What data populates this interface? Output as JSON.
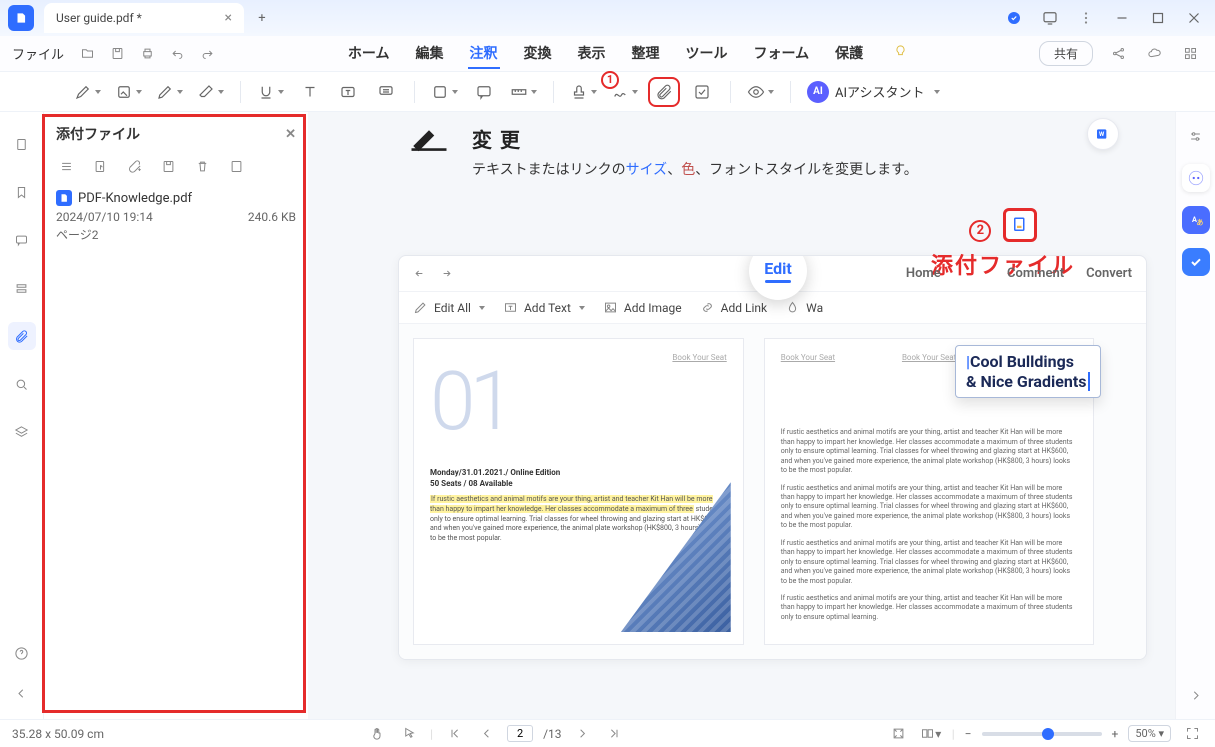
{
  "titlebar": {
    "tab_title": "User guide.pdf *"
  },
  "menubar": {
    "file": "ファイル",
    "items": [
      "ホーム",
      "編集",
      "注釈",
      "変換",
      "表示",
      "整理",
      "ツール",
      "フォーム",
      "保護"
    ],
    "active_index": 2,
    "share": "共有"
  },
  "toolbar": {
    "badge1": "1",
    "ai_label": "AIアシスタント"
  },
  "side_panel": {
    "title": "添付ファイル",
    "file_name": "PDF-Knowledge.pdf",
    "file_date": "2024/07/10 19:14",
    "file_size": "240.6 KB",
    "file_page": "ページ2"
  },
  "doc": {
    "change_title": "変更",
    "change_text_pre": "テキストまたはリンクの",
    "change_size": "サイズ",
    "change_sep1": "、",
    "change_color": "色",
    "change_rest": "、フォントスタイルを変更します。",
    "callout_num": "2",
    "callout_label": "添付ファイル"
  },
  "mock": {
    "tab_home": "Home",
    "tab_edit": "Edit",
    "tab_comment": "Comment",
    "tab_convert": "Convert",
    "t_editall": "Edit All",
    "t_addtext": "Add Text",
    "t_addimage": "Add Image",
    "t_addlink": "Add Link",
    "t_wa": "Wa",
    "crumb": "Book Your Seat",
    "big01": "01",
    "info1": "Monday/31.01.2021./ Online Edition",
    "info2": "50 Seats / 08 Available",
    "cool1": "Cool Bulldings",
    "cool2": "& Nice Gradients"
  },
  "status": {
    "dims": "35.28 x 50.09 cm",
    "page_cur": "2",
    "page_total": "/13",
    "zoom": "50%"
  }
}
